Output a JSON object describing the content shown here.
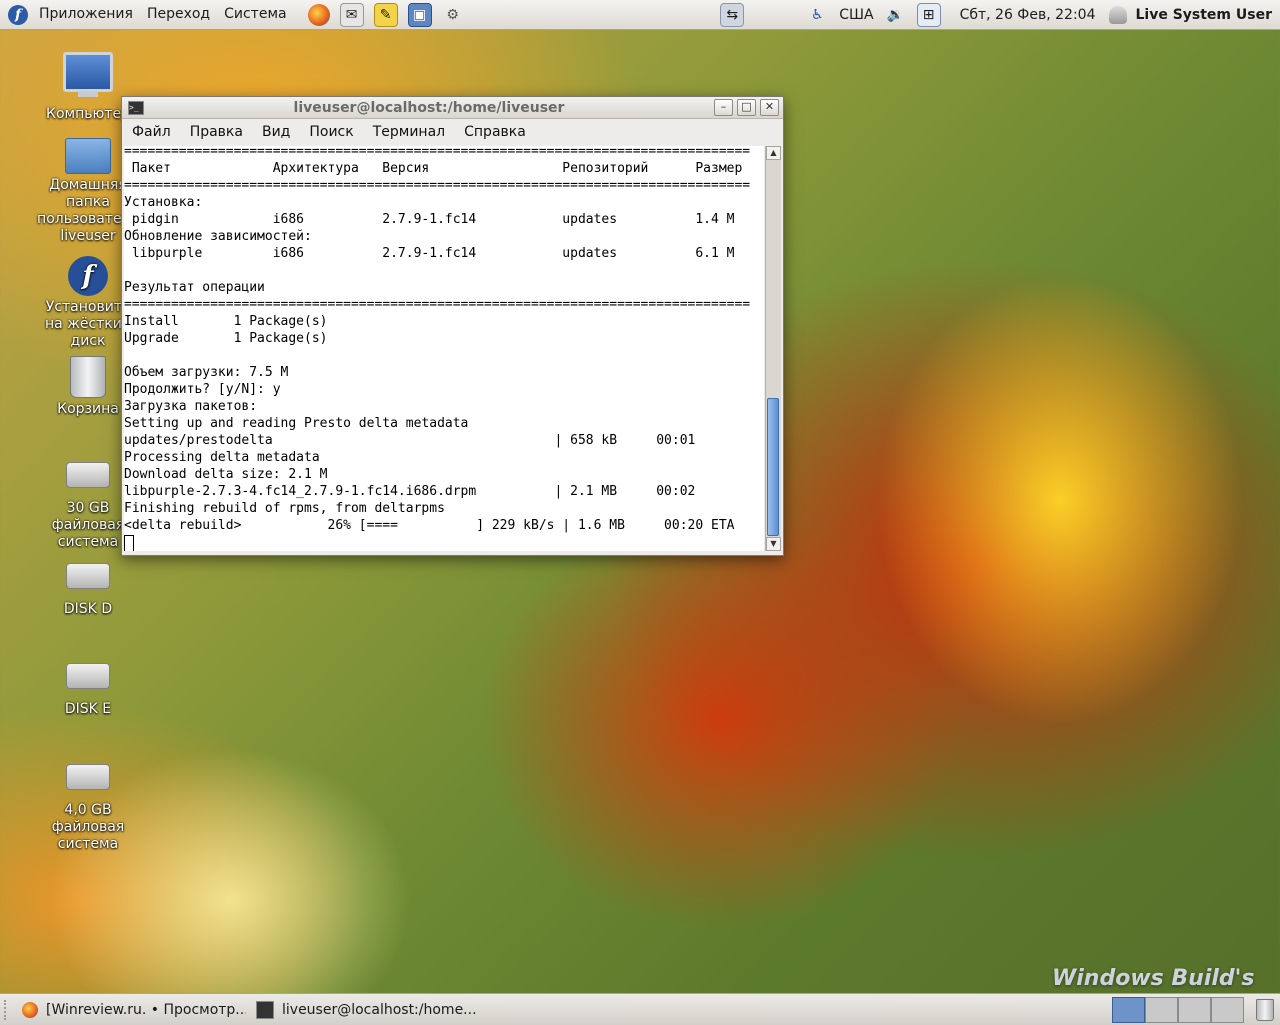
{
  "top_panel": {
    "menu": [
      "Приложения",
      "Переход",
      "Система"
    ],
    "launcher_icons": [
      "firefox-icon",
      "mail-icon",
      "notes-icon",
      "screenshot-icon",
      "settings-icon"
    ],
    "keyboard_layout": "США",
    "clock": "Сбт, 26 Фев, 22:04",
    "user": "Live System User"
  },
  "desktop": {
    "icons": [
      {
        "label": "Компьютер",
        "icon": "computer-icon"
      },
      {
        "label": "Домашняя папка пользователя liveuser",
        "icon": "home-folder-icon"
      },
      {
        "label": "Установить на жёсткий диск",
        "icon": "install-icon"
      },
      {
        "label": "Корзина",
        "icon": "trash-icon"
      },
      {
        "label": "30 GB файловая система",
        "icon": "drive-icon"
      },
      {
        "label": "DISK D",
        "icon": "drive-icon"
      },
      {
        "label": "DISK E",
        "icon": "drive-icon"
      },
      {
        "label": "4,0 GB файловая система",
        "icon": "drive-icon"
      }
    ],
    "watermark": "Windows Build's"
  },
  "terminal": {
    "title": "liveuser@localhost:/home/liveuser",
    "menu": [
      "Файл",
      "Правка",
      "Вид",
      "Поиск",
      "Терминал",
      "Справка"
    ],
    "lines": [
      "================================================================================",
      " Пакет             Архитектура   Версия                 Репозиторий      Размер",
      "================================================================================",
      "Установка:",
      " pidgin            i686          2.7.9-1.fc14           updates          1.4 M",
      "Обновление зависимостей:",
      " libpurple         i686          2.7.9-1.fc14           updates          6.1 M",
      "",
      "Результат операции",
      "================================================================================",
      "Install       1 Package(s)",
      "Upgrade       1 Package(s)",
      "",
      "Объем загрузки: 7.5 M",
      "Продолжить? [y/N]: y",
      "Загрузка пакетов:",
      "Setting up and reading Presto delta metadata",
      "updates/prestodelta                                    | 658 kB     00:01",
      "Processing delta metadata",
      "Download delta size: 2.1 M",
      "libpurple-2.7.3-4.fc14_2.7.9-1.fc14.i686.drpm          | 2.1 MB     00:02",
      "Finishing rebuild of rpms, from deltarpms",
      "<delta rebuild>           26% [====          ] 229 kB/s | 1.6 MB     00:20 ETA"
    ]
  },
  "taskbar": {
    "tasks": [
      "[Winreview.ru. • Просмотр...",
      "liveuser@localhost:/home..."
    ],
    "workspaces": 4,
    "active_workspace": 1
  }
}
